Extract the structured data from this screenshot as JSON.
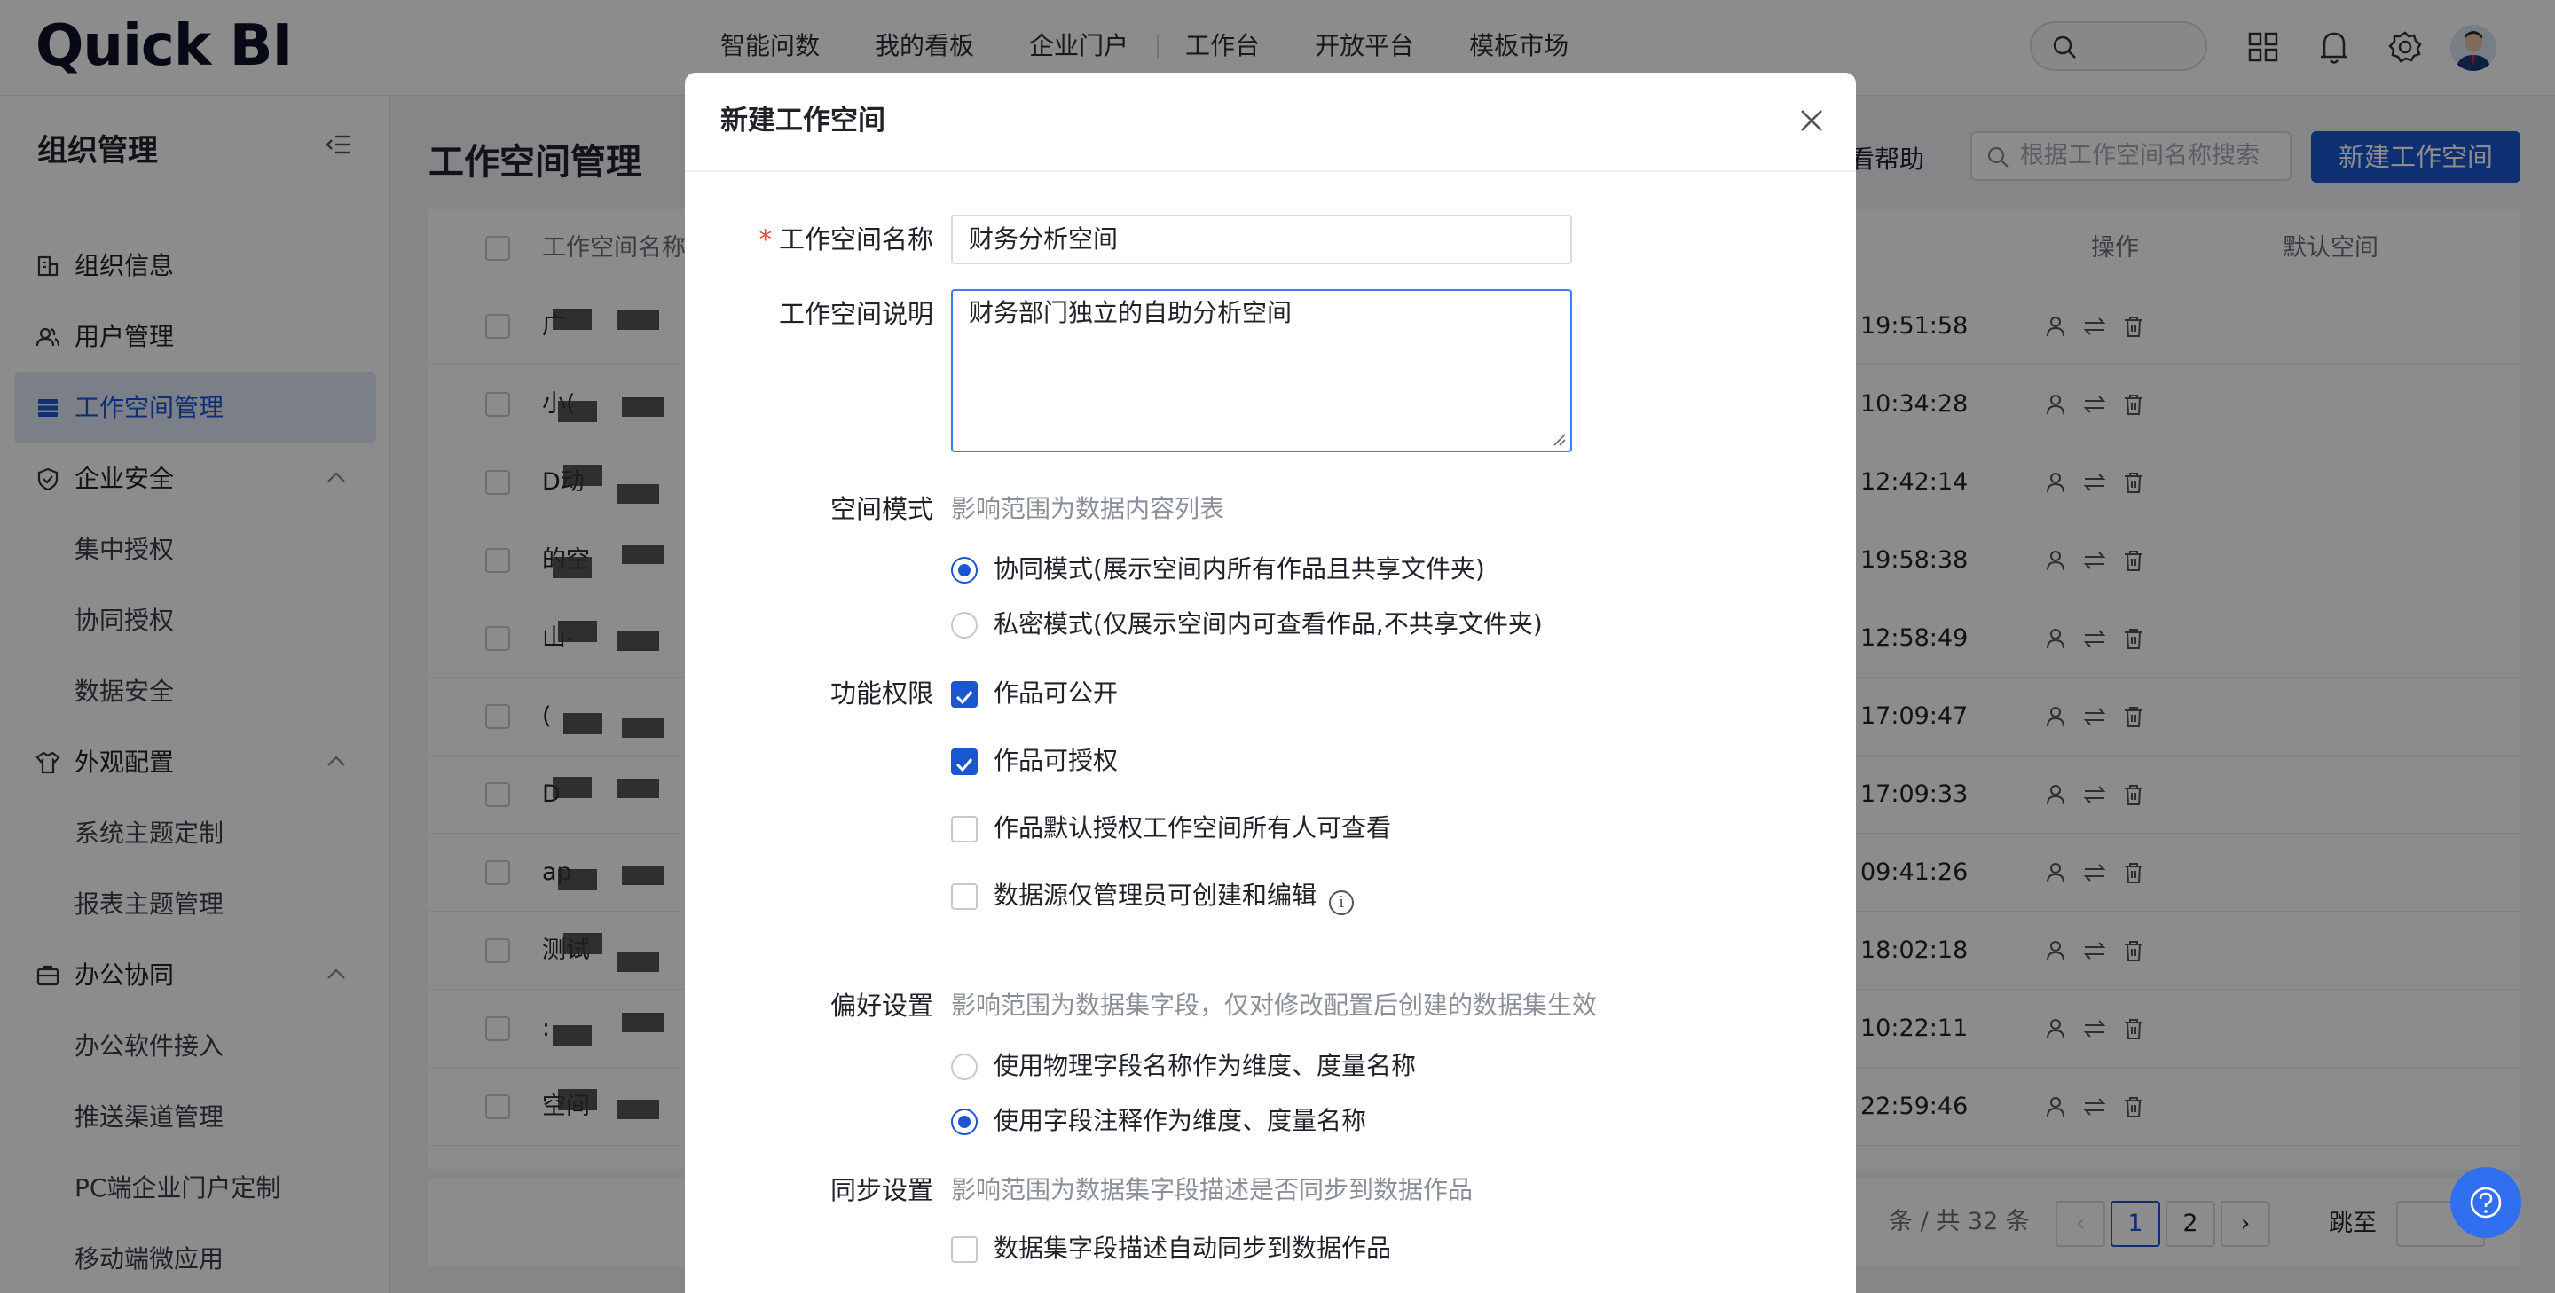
{
  "brand": {
    "logo": "Quick BI",
    "accent": "#1b56d0"
  },
  "topnav": [
    "智能问数",
    "我的看板",
    "企业门户",
    "工作台",
    "开放平台",
    "模板市场"
  ],
  "sidebar": {
    "title": "组织管理",
    "items": [
      {
        "label": "组织信息",
        "icon": "building-icon"
      },
      {
        "label": "用户管理",
        "icon": "users-icon"
      },
      {
        "label": "工作空间管理",
        "icon": "workspace-icon",
        "active": true
      },
      {
        "label": "企业安全",
        "icon": "shield-icon",
        "group": true
      },
      {
        "label": "集中授权"
      },
      {
        "label": "协同授权"
      },
      {
        "label": "数据安全"
      },
      {
        "label": "外观配置",
        "icon": "shirt-icon",
        "group": true
      },
      {
        "label": "系统主题定制"
      },
      {
        "label": "报表主题管理"
      },
      {
        "label": "办公协同",
        "icon": "office-icon",
        "group": true
      },
      {
        "label": "办公软件接入"
      },
      {
        "label": "推送渠道管理"
      },
      {
        "label": "PC端企业门户定制"
      },
      {
        "label": "移动端微应用"
      }
    ]
  },
  "main": {
    "title": "工作空间管理",
    "help": "查看帮助",
    "search_placeholder": "根据工作空间名称搜索",
    "new_button": "新建工作空间",
    "columns": {
      "name": "工作空间名称",
      "ops": "操作",
      "default": "默认空间"
    },
    "rows": [
      {
        "name": "广",
        "time": "19:51:58"
      },
      {
        "name": "小(",
        "time": "10:34:28"
      },
      {
        "name": "D动",
        "time": "12:42:14"
      },
      {
        "name": "的空",
        "time": "19:58:38"
      },
      {
        "name": "山-",
        "time": "12:58:49"
      },
      {
        "name": "(",
        "time": "17:09:47"
      },
      {
        "name": "D",
        "time": "17:09:33"
      },
      {
        "name": "ap",
        "time": "09:41:26"
      },
      {
        "name": "测试",
        "time": "18:02:18"
      },
      {
        "name": ":",
        "time": "10:22:11"
      },
      {
        "name": "空间",
        "time": "22:59:46"
      }
    ],
    "pager": {
      "summary": "条 / 共 32 条",
      "pages": [
        "1",
        "2"
      ],
      "current": "1",
      "jump": "跳至"
    }
  },
  "modal": {
    "title": "新建工作空间",
    "name_label": "工作空间名称",
    "name_value": "财务分析空间",
    "desc_label": "工作空间说明",
    "desc_value": "财务部门独立的自助分析空间",
    "mode_label": "空间模式",
    "mode_hint": "影响范围为数据内容列表",
    "mode_options": [
      {
        "label": "协同模式(展示空间内所有作品且共享文件夹)",
        "checked": true
      },
      {
        "label": "私密模式(仅展示空间内可查看作品,不共享文件夹)",
        "checked": false
      }
    ],
    "perm_label": "功能权限",
    "perm_options": [
      {
        "label": "作品可公开",
        "checked": true
      },
      {
        "label": "作品可授权",
        "checked": true
      },
      {
        "label": "作品默认授权工作空间所有人可查看",
        "checked": false
      },
      {
        "label": "数据源仅管理员可创建和编辑",
        "checked": false,
        "info": "i"
      }
    ],
    "pref_label": "偏好设置",
    "pref_hint": "影响范围为数据集字段，仅对修改配置后创建的数据集生效",
    "pref_options": [
      {
        "label": "使用物理字段名称作为维度、度量名称",
        "checked": false
      },
      {
        "label": "使用字段注释作为维度、度量名称",
        "checked": true
      }
    ],
    "sync_label": "同步设置",
    "sync_hint": "影响范围为数据集字段描述是否同步到数据作品",
    "sync_options": [
      {
        "label": "数据集字段描述自动同步到数据作品",
        "checked": false
      }
    ]
  }
}
